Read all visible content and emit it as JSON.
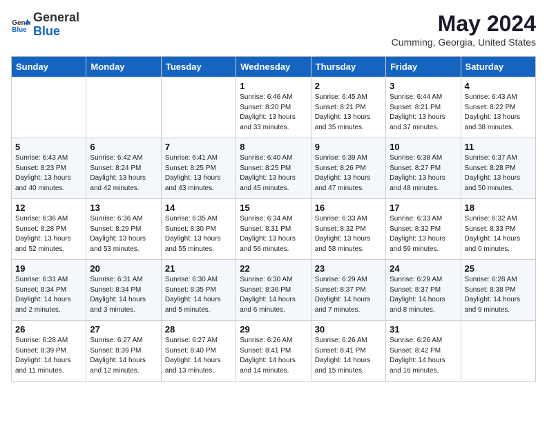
{
  "header": {
    "logo_general": "General",
    "logo_blue": "Blue",
    "month_year": "May 2024",
    "location": "Cumming, Georgia, United States"
  },
  "days_of_week": [
    "Sunday",
    "Monday",
    "Tuesday",
    "Wednesday",
    "Thursday",
    "Friday",
    "Saturday"
  ],
  "weeks": [
    [
      null,
      null,
      null,
      {
        "day": "1",
        "sunrise": "6:46 AM",
        "sunset": "8:20 PM",
        "daylight": "13 hours and 33 minutes."
      },
      {
        "day": "2",
        "sunrise": "6:45 AM",
        "sunset": "8:21 PM",
        "daylight": "13 hours and 35 minutes."
      },
      {
        "day": "3",
        "sunrise": "6:44 AM",
        "sunset": "8:21 PM",
        "daylight": "13 hours and 37 minutes."
      },
      {
        "day": "4",
        "sunrise": "6:43 AM",
        "sunset": "8:22 PM",
        "daylight": "13 hours and 38 minutes."
      }
    ],
    [
      {
        "day": "5",
        "sunrise": "6:43 AM",
        "sunset": "8:23 PM",
        "daylight": "13 hours and 40 minutes."
      },
      {
        "day": "6",
        "sunrise": "6:42 AM",
        "sunset": "8:24 PM",
        "daylight": "13 hours and 42 minutes."
      },
      {
        "day": "7",
        "sunrise": "6:41 AM",
        "sunset": "8:25 PM",
        "daylight": "13 hours and 43 minutes."
      },
      {
        "day": "8",
        "sunrise": "6:40 AM",
        "sunset": "8:25 PM",
        "daylight": "13 hours and 45 minutes."
      },
      {
        "day": "9",
        "sunrise": "6:39 AM",
        "sunset": "8:26 PM",
        "daylight": "13 hours and 47 minutes."
      },
      {
        "day": "10",
        "sunrise": "6:38 AM",
        "sunset": "8:27 PM",
        "daylight": "13 hours and 48 minutes."
      },
      {
        "day": "11",
        "sunrise": "6:37 AM",
        "sunset": "8:28 PM",
        "daylight": "13 hours and 50 minutes."
      }
    ],
    [
      {
        "day": "12",
        "sunrise": "6:36 AM",
        "sunset": "8:28 PM",
        "daylight": "13 hours and 52 minutes."
      },
      {
        "day": "13",
        "sunrise": "6:36 AM",
        "sunset": "8:29 PM",
        "daylight": "13 hours and 53 minutes."
      },
      {
        "day": "14",
        "sunrise": "6:35 AM",
        "sunset": "8:30 PM",
        "daylight": "13 hours and 55 minutes."
      },
      {
        "day": "15",
        "sunrise": "6:34 AM",
        "sunset": "8:31 PM",
        "daylight": "13 hours and 56 minutes."
      },
      {
        "day": "16",
        "sunrise": "6:33 AM",
        "sunset": "8:32 PM",
        "daylight": "13 hours and 58 minutes."
      },
      {
        "day": "17",
        "sunrise": "6:33 AM",
        "sunset": "8:32 PM",
        "daylight": "13 hours and 59 minutes."
      },
      {
        "day": "18",
        "sunrise": "6:32 AM",
        "sunset": "8:33 PM",
        "daylight": "14 hours and 0 minutes."
      }
    ],
    [
      {
        "day": "19",
        "sunrise": "6:31 AM",
        "sunset": "8:34 PM",
        "daylight": "14 hours and 2 minutes."
      },
      {
        "day": "20",
        "sunrise": "6:31 AM",
        "sunset": "8:34 PM",
        "daylight": "14 hours and 3 minutes."
      },
      {
        "day": "21",
        "sunrise": "6:30 AM",
        "sunset": "8:35 PM",
        "daylight": "14 hours and 5 minutes."
      },
      {
        "day": "22",
        "sunrise": "6:30 AM",
        "sunset": "8:36 PM",
        "daylight": "14 hours and 6 minutes."
      },
      {
        "day": "23",
        "sunrise": "6:29 AM",
        "sunset": "8:37 PM",
        "daylight": "14 hours and 7 minutes."
      },
      {
        "day": "24",
        "sunrise": "6:29 AM",
        "sunset": "8:37 PM",
        "daylight": "14 hours and 8 minutes."
      },
      {
        "day": "25",
        "sunrise": "6:28 AM",
        "sunset": "8:38 PM",
        "daylight": "14 hours and 9 minutes."
      }
    ],
    [
      {
        "day": "26",
        "sunrise": "6:28 AM",
        "sunset": "8:39 PM",
        "daylight": "14 hours and 11 minutes."
      },
      {
        "day": "27",
        "sunrise": "6:27 AM",
        "sunset": "8:39 PM",
        "daylight": "14 hours and 12 minutes."
      },
      {
        "day": "28",
        "sunrise": "6:27 AM",
        "sunset": "8:40 PM",
        "daylight": "14 hours and 13 minutes."
      },
      {
        "day": "29",
        "sunrise": "6:26 AM",
        "sunset": "8:41 PM",
        "daylight": "14 hours and 14 minutes."
      },
      {
        "day": "30",
        "sunrise": "6:26 AM",
        "sunset": "8:41 PM",
        "daylight": "14 hours and 15 minutes."
      },
      {
        "day": "31",
        "sunrise": "6:26 AM",
        "sunset": "8:42 PM",
        "daylight": "14 hours and 16 minutes."
      },
      null
    ]
  ]
}
